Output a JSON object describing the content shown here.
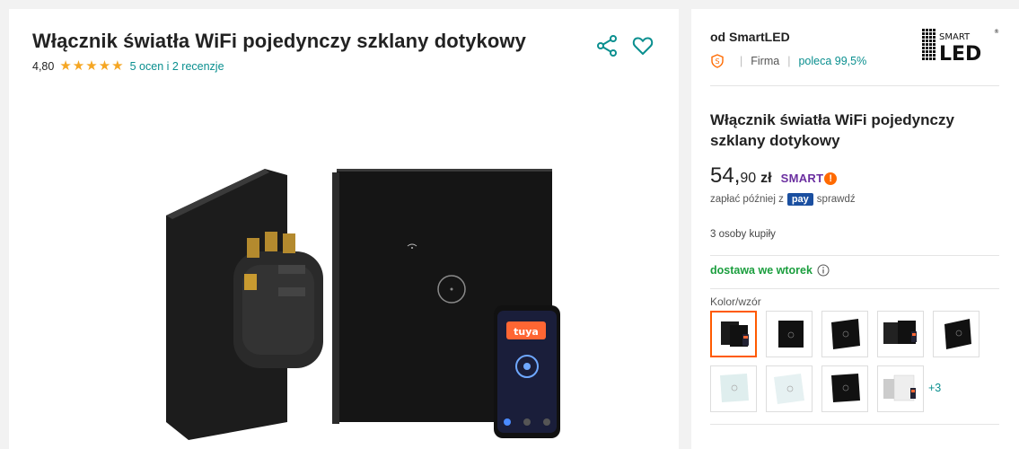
{
  "product": {
    "title": "Włącznik światła WiFi pojedynczy szklany dotykowy",
    "rating": "4,80",
    "stars": 5,
    "reviews_link": "5 ocen i 2 recenzje"
  },
  "icons": {
    "share": "share-icon",
    "favorite": "heart-icon"
  },
  "seller": {
    "name": "od SmartLED",
    "type": "Firma",
    "recommend": "poleca 99,5%",
    "logo_top": "SMART",
    "logo_bottom": "LED"
  },
  "offer": {
    "title": "Włącznik światła WiFi pojedynczy szklany dotykowy",
    "price_main": "54,",
    "price_cents": "90",
    "currency": "zł",
    "smart_label": "SMART",
    "pay_later_prefix": "zapłać później z",
    "pay_badge": "pay",
    "pay_check": "sprawdź",
    "buyers": "3 osoby kupiły",
    "delivery": "dostawa we wtorek",
    "variant_label": "Kolor/wzór",
    "more_variants": "+3"
  },
  "phone_app": {
    "brand": "tuya"
  },
  "colors": {
    "accent": "#0a8f8f",
    "star": "#f5a623",
    "delivery": "#1b9e3e",
    "selected": "#ff5a00",
    "smart": "#6b2fa0"
  }
}
